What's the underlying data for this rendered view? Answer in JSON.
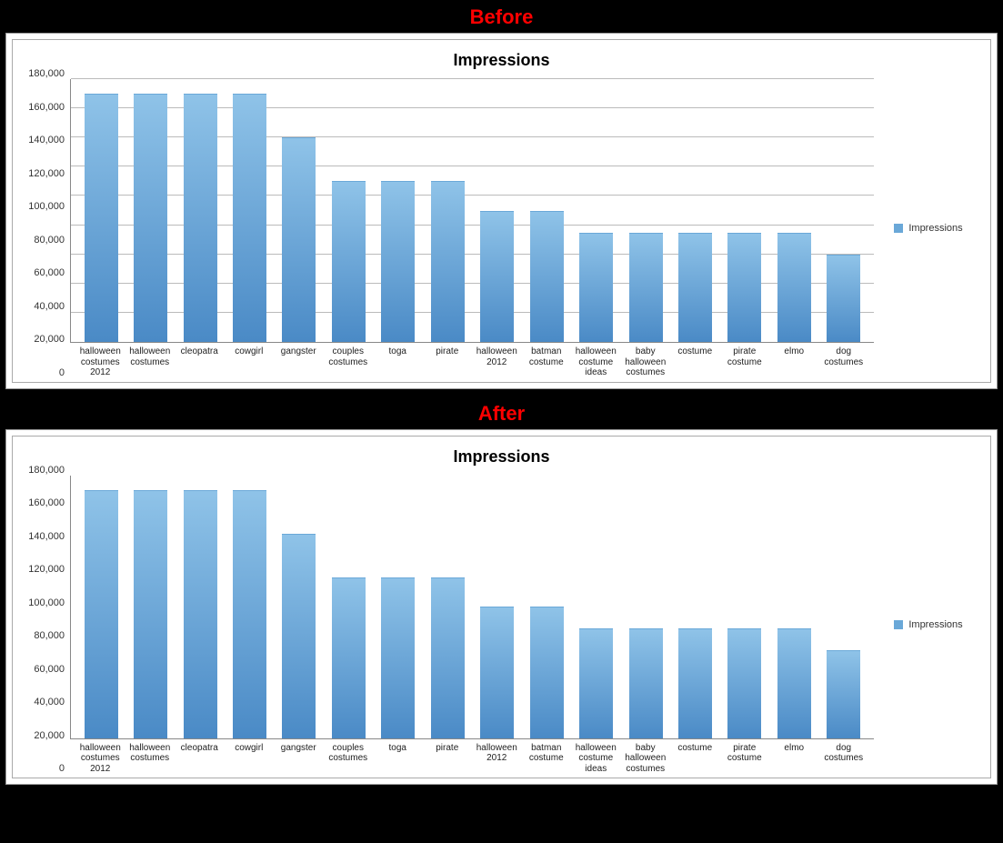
{
  "labels": {
    "before": "Before",
    "after": "After"
  },
  "chart_data": [
    {
      "id": "before",
      "type": "bar",
      "title": "Impressions",
      "legend": "Impressions",
      "gridlines": true,
      "ylim": [
        0,
        180000
      ],
      "y_ticks": [
        "0",
        "20,000",
        "40,000",
        "60,000",
        "80,000",
        "100,000",
        "120,000",
        "140,000",
        "160,000",
        "180,000"
      ],
      "categories": [
        "halloween costumes 2012",
        "halloween costumes",
        "cleopatra",
        "cowgirl",
        "gangster",
        "couples costumes",
        "toga",
        "pirate",
        "halloween 2012",
        "batman costume",
        "halloween costume ideas",
        "baby halloween costumes",
        "costume",
        "pirate costume",
        "elmo",
        "dog costumes"
      ],
      "values": [
        170000,
        170000,
        170000,
        170000,
        140000,
        110000,
        110000,
        110000,
        90000,
        90000,
        75000,
        75000,
        75000,
        75000,
        75000,
        60000
      ]
    },
    {
      "id": "after",
      "type": "bar",
      "title": "Impressions",
      "legend": "Impressions",
      "gridlines": false,
      "ylim": [
        0,
        180000
      ],
      "y_ticks": [
        "0",
        "20,000",
        "40,000",
        "60,000",
        "80,000",
        "100,000",
        "120,000",
        "140,000",
        "160,000",
        "180,000"
      ],
      "categories": [
        "halloween costumes 2012",
        "halloween costumes",
        "cleopatra",
        "cowgirl",
        "gangster",
        "couples costumes",
        "toga",
        "pirate",
        "halloween 2012",
        "batman costume",
        "halloween costume ideas",
        "baby halloween costumes",
        "costume",
        "pirate costume",
        "elmo",
        "dog costumes"
      ],
      "values": [
        170000,
        170000,
        170000,
        170000,
        140000,
        110000,
        110000,
        110000,
        90000,
        90000,
        75000,
        75000,
        75000,
        75000,
        75000,
        60000
      ]
    }
  ]
}
